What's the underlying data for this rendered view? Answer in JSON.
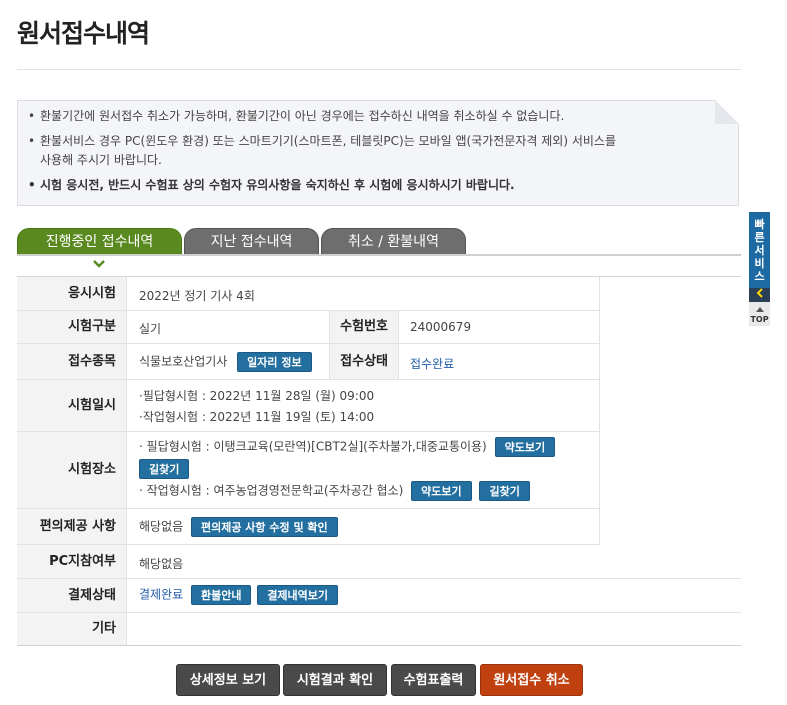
{
  "page_title": "원서접수내역",
  "notice": {
    "lines": [
      "환불기간에 원서접수 취소가 가능하며, 환불기간이 아닌 경우에는 접수하신 내역을 취소하실 수 없습니다.",
      "환불서비스 경우 PC(윈도우 환경) 또는 스마트기기(스마트폰, 테블릿PC)는 모바일 앱(국가전문자격 제외) 서비스를",
      "사용해 주시기 바랍니다.",
      "시험 응시전, 반드시 수험표 상의 수험자 유의사항을 숙지하신 후 시험에 응시하시기 바랍니다."
    ]
  },
  "tabs": [
    {
      "label": "진행중인 접수내역"
    },
    {
      "label": "지난 접수내역"
    },
    {
      "label": "취소 / 환불내역"
    }
  ],
  "info": {
    "exam_label": "응시시험",
    "exam_value": "2022년 정기 기사 4회",
    "type_label": "시험구분",
    "type_value": "실기",
    "number_label": "수험번호",
    "number_value": "24000679",
    "item_label": "접수종목",
    "item_value": "식물보호산업기사",
    "job_btn": "일자리 정보",
    "status_label": "접수상태",
    "status_value": "접수완료",
    "date_label": "시험일시",
    "date_written": "·필답형시험 : 2022년 11월 28일 (월) 09:00",
    "date_practical": "·작업형시험 : 2022년 11월 19일 (토) 14:00",
    "place_label": "시험장소",
    "place_written": "· 필답형시험 : 이탱크교육(모란역)[CBT2실](주차불가,대중교통이용)",
    "place_practical": "· 작업형시험 : 여주농업경영전문학교(주차공간 협소)",
    "map_btn": "약도보기",
    "route_btn": "길찾기",
    "conv_label": "편의제공 사항",
    "conv_value": "해당없음",
    "conv_btn": "편의제공 사항 수정 및 확인",
    "pc_label": "PC지참여부",
    "pc_value": "해당없음",
    "pay_label": "결제상태",
    "pay_value": "결제완료",
    "refund_btn": "환불안내",
    "pay_detail_btn": "결제내역보기",
    "etc_label": "기타",
    "etc_value": ""
  },
  "actions": {
    "detail": "상세정보 보기",
    "result": "시험결과 확인",
    "ticket": "수험표출력",
    "cancel": "원서접수 취소"
  },
  "side": {
    "quick": "빠른서비스",
    "top": "TOP"
  }
}
